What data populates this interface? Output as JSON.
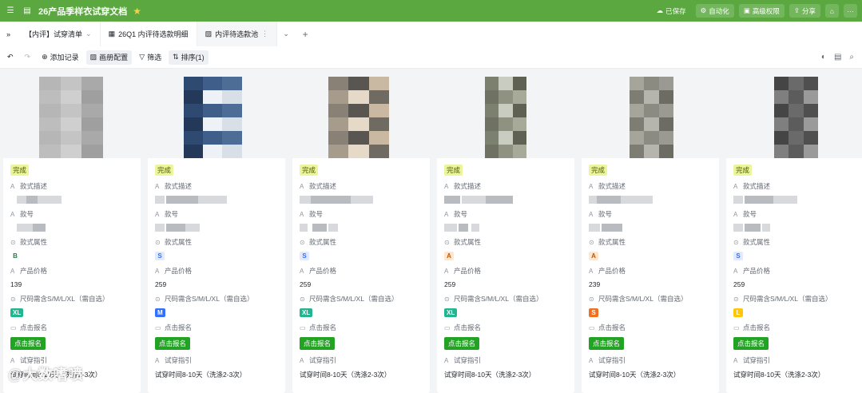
{
  "topbar": {
    "title": "26产品季样衣试穿文档",
    "saved": "已保存",
    "buttons": {
      "automation": "自动化",
      "advanced_perm": "高级权限",
      "share": "分享"
    }
  },
  "tabs": [
    {
      "label": "【内评】试穿清单"
    },
    {
      "label": "26Q1 内评待选款明细"
    },
    {
      "label": "内评待选款池"
    }
  ],
  "toolbar": {
    "add_record": "添加记录",
    "image_settings": "画册配置",
    "filter": "筛选",
    "sort": "排序(1)"
  },
  "field_labels": {
    "status": "完成",
    "desc": "款式描述",
    "code": "款号",
    "attr": "款式属性",
    "price": "产品价格",
    "size": "尺码需含S/M/L/XL（需自选）",
    "signup": "点击报名",
    "guide": "试穿指引"
  },
  "cards": [
    {
      "attr": "B",
      "attr_color": "#2b7a4b",
      "attr_bg": "#ffffff",
      "price": "139",
      "size": "XL",
      "size_bg": "#23b58f",
      "size_color": "#ffffff",
      "signup": "点击报名",
      "guide": "试穿时间8-10天（洗涤2-3次）"
    },
    {
      "attr": "S",
      "attr_color": "#3370ff",
      "attr_bg": "#e1eaff",
      "price": "259",
      "size": "M",
      "size_bg": "#3370ff",
      "size_color": "#ffffff",
      "signup": "点击报名",
      "guide": "试穿时间8-10天（洗涤2-3次）"
    },
    {
      "attr": "S",
      "attr_color": "#3370ff",
      "attr_bg": "#e1eaff",
      "price": "259",
      "size": "XL",
      "size_bg": "#23b58f",
      "size_color": "#ffffff",
      "signup": "点击报名",
      "guide": "试穿时间8-10天（洗涤2-3次）"
    },
    {
      "attr": "A",
      "attr_color": "#c25400",
      "attr_bg": "#fee7cd",
      "price": "259",
      "size": "XL",
      "size_bg": "#23b58f",
      "size_color": "#ffffff",
      "signup": "点击报名",
      "guide": "试穿时间8-10天（洗涤2-3次）"
    },
    {
      "attr": "A",
      "attr_color": "#c25400",
      "attr_bg": "#fee7cd",
      "price": "239",
      "size": "S",
      "size_bg": "#f0701f",
      "size_color": "#ffffff",
      "signup": "点击报名",
      "guide": "试穿时间8-10天（洗涤2-3次）"
    },
    {
      "attr": "S",
      "attr_color": "#3370ff",
      "attr_bg": "#e1eaff",
      "price": "259",
      "size": "L",
      "size_bg": "#ffc60a",
      "size_color": "#ffffff",
      "signup": "点击报名",
      "guide": "试穿时间8-10天（洗涤2-3次）"
    }
  ],
  "watermark": "@大数嗜喷"
}
